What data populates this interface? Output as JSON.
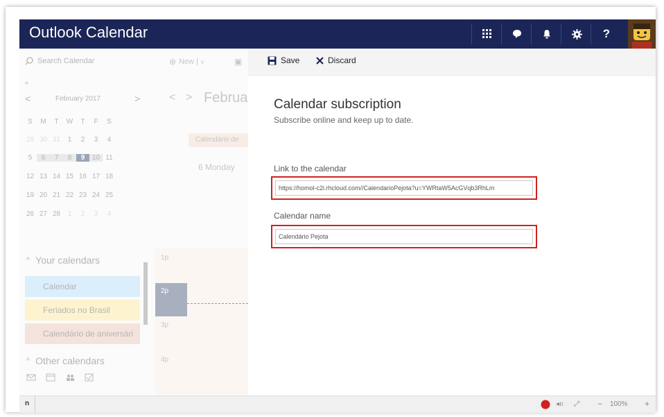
{
  "header": {
    "title": "Outlook Calendar",
    "icons": [
      "apps-grid-icon",
      "feedback-icon",
      "bell-icon",
      "gear-icon",
      "help-icon"
    ],
    "help_label": "?"
  },
  "left": {
    "search_placeholder": "Search Calendar",
    "collapse_label": "«",
    "month_label": "February 2017",
    "weekdays": [
      "S",
      "M",
      "T",
      "W",
      "T",
      "F",
      "S"
    ],
    "weeks": [
      [
        "29",
        "30",
        "31",
        "1",
        "2",
        "3",
        "4"
      ],
      [
        "5",
        "6",
        "7",
        "8",
        "9",
        "10",
        "11"
      ],
      [
        "12",
        "13",
        "14",
        "15",
        "16",
        "17",
        "18"
      ],
      [
        "19",
        "20",
        "21",
        "22",
        "23",
        "24",
        "25"
      ],
      [
        "26",
        "27",
        "28",
        "1",
        "2",
        "3",
        "4"
      ]
    ],
    "selected_day": "9",
    "your_calendars_label": "Your calendars",
    "calendars": [
      {
        "label": "Calendar",
        "color": "#dbeefb"
      },
      {
        "label": "Feriados no Brasil",
        "color": "#fdf4cf"
      },
      {
        "label": "Calendário de aniversári",
        "color": "#f4e3dc"
      }
    ],
    "other_calendars_label": "Other calendars"
  },
  "middle": {
    "new_label": "New |",
    "month_partial": "Februa",
    "event_chip": "Calendário de",
    "day_label": "6 Monday",
    "hours": [
      "1p",
      "2p",
      "3p",
      "4p"
    ]
  },
  "toolbar": {
    "save_label": "Save",
    "discard_label": "Discard"
  },
  "form": {
    "title": "Calendar subscription",
    "subtitle": "Subscribe online and keep up to date.",
    "link_label": "Link to the calendar",
    "link_value": "https://homol-c2i.rhcloud.com//CalendarioPejota?u=YWRtaW5AcGVqb3RhLm",
    "name_label": "Calendar name",
    "name_value": "Calendário Pejota"
  },
  "status": {
    "left_text": "n",
    "zoom": "100%"
  },
  "colors": {
    "header_bg": "#1b2557",
    "highlight_border": "#d1211f"
  }
}
